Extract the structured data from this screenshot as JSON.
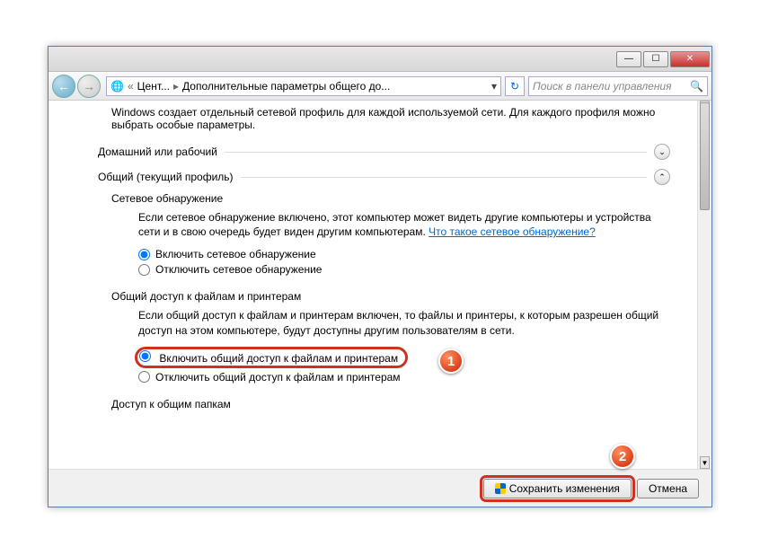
{
  "titlebar": {
    "min": "—",
    "max": "☐",
    "close": "✕"
  },
  "nav": {
    "back": "←",
    "fwd": "→",
    "crumb1": "Цент...",
    "crumb2": "Дополнительные параметры общего до...",
    "refresh": "↻",
    "search_placeholder": "Поиск в панели управления",
    "mag": "🔍"
  },
  "intro": "Windows создает отдельный сетевой профиль для каждой используемой сети. Для каждого профиля можно выбрать особые параметры.",
  "sections": {
    "home": {
      "label": "Домашний или рабочий",
      "chev": "⌄"
    },
    "public": {
      "label": "Общий (текущий профиль)",
      "chev": "⌃"
    }
  },
  "network_discovery": {
    "title": "Сетевое обнаружение",
    "desc": "Если сетевое обнаружение включено, этот компьютер может видеть другие компьютеры и устройства сети и в свою очередь будет виден другим компьютерам. ",
    "link": "Что такое сетевое обнаружение?",
    "opt_on": "Включить сетевое обнаружение",
    "opt_off": "Отключить сетевое обнаружение"
  },
  "file_sharing": {
    "title": "Общий доступ к файлам и принтерам",
    "desc": "Если общий доступ к файлам и принтерам включен, то файлы и принтеры, к которым разрешен общий доступ на этом компьютере, будут доступны другим пользователям в сети.",
    "opt_on": "Включить общий доступ к файлам и принтерам",
    "opt_off": "Отключить общий доступ к файлам и принтерам"
  },
  "public_folders": {
    "title": "Доступ к общим папкам"
  },
  "footer": {
    "save": "Сохранить изменения",
    "cancel": "Отмена"
  },
  "callouts": {
    "c1": "1",
    "c2": "2"
  }
}
